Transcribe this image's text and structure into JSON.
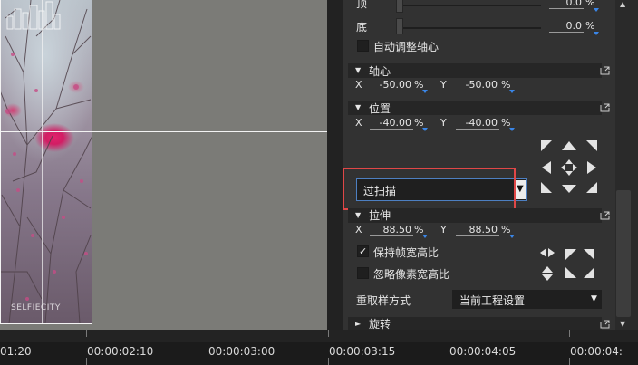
{
  "preview": {
    "watermark_text": "SELFIECITY"
  },
  "panel": {
    "top_label": "顶",
    "top_value": "0.0",
    "bottom_label": "底",
    "bottom_value": "0.0",
    "percent": "%",
    "auto_center_label": "自动调整轴心",
    "axis_section": "轴心",
    "axis_x": "-50.00",
    "axis_y": "-50.00",
    "position_section": "位置",
    "pos_x": "-40.00",
    "pos_y": "-40.00",
    "x_label": "X",
    "y_label": "Y",
    "overscan_value": "过扫描",
    "stretch_section": "拉伸",
    "stretch_x": "88.50",
    "stretch_y": "88.50",
    "keep_ratio_label": "保持帧宽高比",
    "keep_ratio_checked": true,
    "ignore_pixel_label": "忽略像素宽高比",
    "ignore_pixel_checked": false,
    "resample_label": "重取样方式",
    "resample_value": "当前工程设置",
    "rotation_section": "旋转"
  },
  "timeline": {
    "timecodes": [
      "01:20",
      "00:00:02:10",
      "00:00:03:00",
      "00:00:03:15",
      "00:00:04:05",
      "00:00:04:"
    ]
  },
  "colors": {
    "panel_bg": "#323232",
    "accent_blue": "#3a86e8",
    "highlight_red": "#e04747"
  }
}
